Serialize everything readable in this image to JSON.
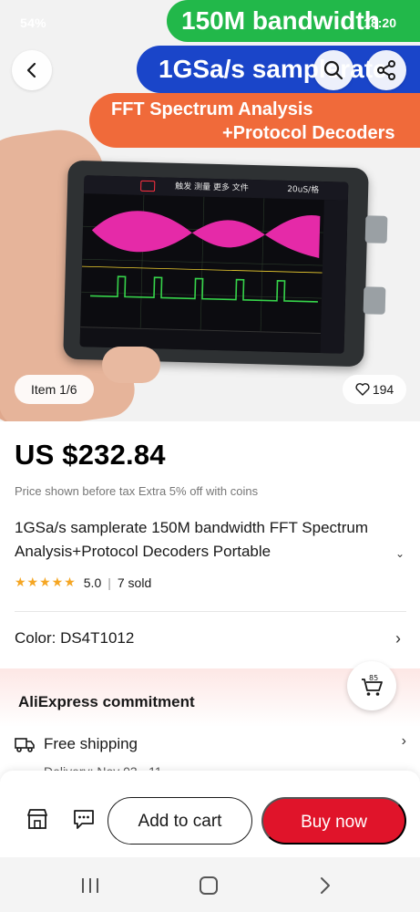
{
  "status_bar": {
    "battery": "54%",
    "time": "18:20"
  },
  "hero": {
    "banners": {
      "green": "150M bandwidth",
      "blue": "1GSa/s samplerate",
      "orange_line1": "FFT Spectrum Analysis",
      "orange_line2": "+Protocol Decoders"
    },
    "device_screen_menu": "触发  测量  更多  文件",
    "device_timebase": "20uS/格",
    "item_counter": "Item 1/6",
    "likes": "194"
  },
  "product": {
    "price": "US $232.84",
    "price_note": "Price shown before tax Extra 5% off with coins",
    "title": "1GSa/s samplerate 150M bandwidth FFT Spectrum Analysis+Protocol Decoders Portable",
    "rating": "5.0",
    "sold": "7 sold",
    "color_label": "Color: DS4T1012"
  },
  "commitment": {
    "title": "AliExpress commitment",
    "shipping_label": "Free shipping",
    "delivery_text": "Delivery: Nov 03 - 11",
    "coupon_value": "85"
  },
  "actions": {
    "add_to_cart": "Add to cart",
    "buy_now": "Buy now"
  },
  "colors": {
    "accent_red": "#e0142a",
    "banner_green": "#22b84a",
    "banner_blue": "#1a45c9",
    "banner_orange": "#f06a3a",
    "star": "#f5a623"
  }
}
